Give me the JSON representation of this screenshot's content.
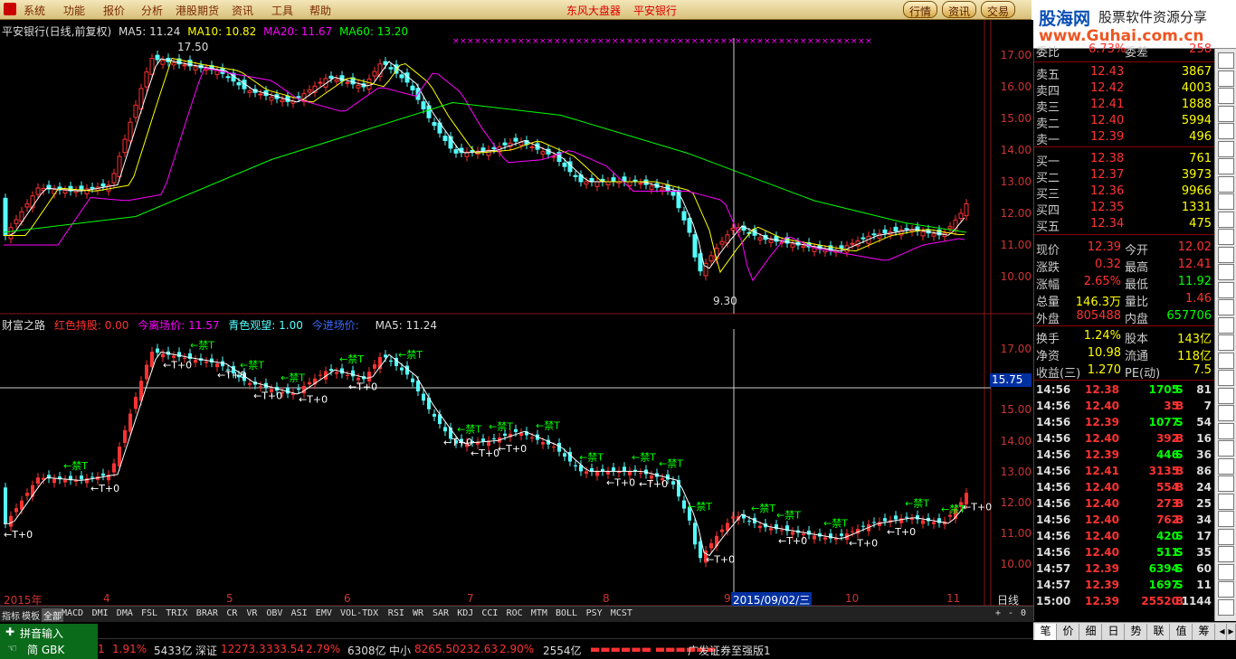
{
  "menu": {
    "items": [
      "系统",
      "功能",
      "报价",
      "分析",
      "港股期货",
      "资讯",
      "工具",
      "帮助"
    ],
    "center_title": "东风大盘器",
    "stock_title": "平安银行",
    "right_buttons": [
      "行情",
      "资讯",
      "交易"
    ]
  },
  "brand": {
    "name": "股海网",
    "slogan": "股票软件资源分享",
    "url": "www.Guhai.com.cn"
  },
  "main_chart": {
    "title": "平安银行(日线,前复权)",
    "ma5": "MA5: 11.24",
    "ma10": "MA10: 10.82",
    "ma20": "MA20: 11.67",
    "ma60": "MA60: 13.20",
    "high_label": "17.50",
    "low_label": "9.30",
    "y_ticks": [
      "17.00",
      "16.00",
      "15.00",
      "14.00",
      "13.00",
      "12.00",
      "11.00",
      "10.00"
    ]
  },
  "indicator": {
    "name": "财富之路",
    "hold": "红色持股: 0.00",
    "exit": "今离场价: 11.57",
    "watch": "青色观望: 1.00",
    "enter": "今进场价:",
    "ma5": "MA5: 11.24",
    "y_ticks": [
      "17.00",
      "16.00",
      "15.00",
      "14.00",
      "13.00",
      "12.00",
      "11.00",
      "10.00"
    ],
    "crosshair_value": "15.75",
    "marker_up": "禁T",
    "marker_down": "T+0"
  },
  "x_axis": {
    "labels": [
      "2015年",
      "4",
      "5",
      "6",
      "7",
      "8",
      "9",
      "10",
      "11"
    ],
    "cursor_date": "2015/09/02/三",
    "period": "日线"
  },
  "indicator_tabs": [
    "指标",
    "模板",
    "全部",
    "MACD",
    "DMI",
    "DMA",
    "FSL",
    "TRIX",
    "BRAR",
    "CR",
    "VR",
    "OBV",
    "ASI",
    "EMV",
    "VOL-TDX",
    "RSI",
    "WR",
    "SAR",
    "KDJ",
    "CCI",
    "ROC",
    "MTM",
    "BOLL",
    "PSY",
    "MCST"
  ],
  "chart_data": {
    "type": "line",
    "series": [
      {
        "name": "MA5"
      },
      {
        "name": "MA10"
      },
      {
        "name": "MA20"
      },
      {
        "name": "MA60"
      }
    ],
    "ylim": [
      9.3,
      17.5
    ]
  },
  "quote": {
    "partial_top": {
      "left": "委比",
      "mid": "6.73%",
      "right": "委差",
      "val": "258"
    },
    "asks": [
      {
        "label": "卖五",
        "price": "12.43",
        "vol": "3867"
      },
      {
        "label": "卖四",
        "price": "12.42",
        "vol": "4003"
      },
      {
        "label": "卖三",
        "price": "12.41",
        "vol": "1888"
      },
      {
        "label": "卖二",
        "price": "12.40",
        "vol": "5994"
      },
      {
        "label": "卖一",
        "price": "12.39",
        "vol": "496"
      }
    ],
    "bids": [
      {
        "label": "买一",
        "price": "12.38",
        "vol": "761"
      },
      {
        "label": "买二",
        "price": "12.37",
        "vol": "3973"
      },
      {
        "label": "买三",
        "price": "12.36",
        "vol": "9966"
      },
      {
        "label": "买四",
        "price": "12.35",
        "vol": "1331"
      },
      {
        "label": "买五",
        "price": "12.34",
        "vol": "475"
      }
    ],
    "stats": [
      {
        "l1": "现价",
        "v1": "12.39",
        "l2": "今开",
        "v2": "12.02"
      },
      {
        "l1": "涨跌",
        "v1": "0.32",
        "l2": "最高",
        "v2": "12.41"
      },
      {
        "l1": "涨幅",
        "v1": "2.65%",
        "l2": "最低",
        "v2": "11.92"
      },
      {
        "l1": "总量",
        "v1": "146.3万",
        "l2": "量比",
        "v2": "1.46"
      },
      {
        "l1": "外盘",
        "v1": "805488",
        "l2": "内盘",
        "v2": "657706"
      },
      {
        "l1": "换手",
        "v1": "1.24%",
        "l2": "股本",
        "v2": "143亿"
      },
      {
        "l1": "净资",
        "v1": "10.98",
        "l2": "流通",
        "v2": "118亿"
      },
      {
        "l1": "收益(三)",
        "v1": "1.270",
        "l2": "PE(动)",
        "v2": "7.5"
      }
    ],
    "ticks": [
      {
        "t": "14:56",
        "p": "12.38",
        "v": "1705",
        "s": "S",
        "n": "81"
      },
      {
        "t": "14:56",
        "p": "12.40",
        "v": "35",
        "s": "B",
        "n": "7"
      },
      {
        "t": "14:56",
        "p": "12.39",
        "v": "1077",
        "s": "S",
        "n": "54"
      },
      {
        "t": "14:56",
        "p": "12.40",
        "v": "392",
        "s": "B",
        "n": "16"
      },
      {
        "t": "14:56",
        "p": "12.39",
        "v": "446",
        "s": "S",
        "n": "36"
      },
      {
        "t": "14:56",
        "p": "12.41",
        "v": "3135",
        "s": "B",
        "n": "86"
      },
      {
        "t": "14:56",
        "p": "12.40",
        "v": "554",
        "s": "B",
        "n": "24"
      },
      {
        "t": "14:56",
        "p": "12.40",
        "v": "273",
        "s": "B",
        "n": "25"
      },
      {
        "t": "14:56",
        "p": "12.40",
        "v": "762",
        "s": "B",
        "n": "34"
      },
      {
        "t": "14:56",
        "p": "12.40",
        "v": "420",
        "s": "S",
        "n": "17"
      },
      {
        "t": "14:56",
        "p": "12.40",
        "v": "511",
        "s": "S",
        "n": "35"
      },
      {
        "t": "14:57",
        "p": "12.39",
        "v": "6394",
        "s": "S",
        "n": "60"
      },
      {
        "t": "14:57",
        "p": "12.39",
        "v": "1697",
        "s": "S",
        "n": "11"
      },
      {
        "t": "15:00",
        "p": "12.39",
        "v": "25520",
        "s": "B",
        "n": "1144"
      }
    ]
  },
  "bottom_tabs": [
    "笔",
    "价",
    "细",
    "日",
    "势",
    "联",
    "值",
    "筹"
  ],
  "pinyin": {
    "label": "拼音输入",
    "mode": "简 GBK"
  },
  "status": {
    "idx1_pct": "1",
    "idx1_chg": "1.91%",
    "idx1_amt": "5433亿",
    "sz_name": "深证",
    "sz_val": "12273.3",
    "sz_chg": "333.54",
    "sz_pct": "2.79%",
    "sz_amt": "6308亿",
    "zx_name": "中小",
    "zx_val": "8265.50",
    "zx_chg": "232.63",
    "zx_pct": "2.90%",
    "zx_amt": "2554亿",
    "broker": "广发证券至强版1"
  },
  "colors": {
    "up": "#ff3232",
    "down": "#54ffff",
    "ma5": "#ffffff",
    "ma10": "#ffff00",
    "ma20": "#ff00ff",
    "ma60": "#00ff00"
  }
}
